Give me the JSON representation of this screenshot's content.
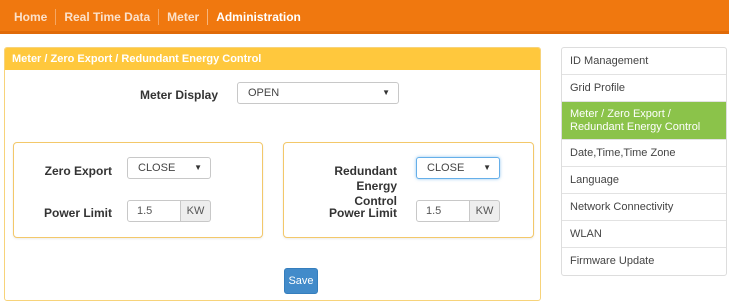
{
  "nav": {
    "items": [
      {
        "label": "Home",
        "active": false
      },
      {
        "label": "Real Time Data",
        "active": false
      },
      {
        "label": "Meter",
        "active": false
      },
      {
        "label": "Administration",
        "active": true
      }
    ]
  },
  "panel": {
    "title": "Meter / Zero Export / Redundant Energy Control",
    "meter_display": {
      "label": "Meter Display",
      "value": "OPEN"
    },
    "zero_export": {
      "label": "Zero Export",
      "value": "CLOSE",
      "power_limit_label": "Power Limit",
      "power_limit_value": "1.5",
      "unit": "KW"
    },
    "redundant": {
      "label_line1": "Redundant Energy",
      "label_line2": "Control",
      "value": "CLOSE",
      "power_limit_label": "Power Limit",
      "power_limit_value": "1.5",
      "unit": "KW"
    },
    "save_label": "Save"
  },
  "sidebar": {
    "items": [
      {
        "label": "ID Management"
      },
      {
        "label": "Grid Profile"
      },
      {
        "label": "Meter / Zero Export / Redundant Energy Control",
        "active": true
      },
      {
        "label": "Date,Time,Time Zone"
      },
      {
        "label": "Language"
      },
      {
        "label": "Network Connectivity"
      },
      {
        "label": "WLAN"
      },
      {
        "label": "Firmware Update"
      }
    ]
  },
  "colors": {
    "topbar": "#f0780f",
    "panel_header": "#ffc83d",
    "sidebar_active": "#8bc34a",
    "save_button": "#428bca"
  }
}
